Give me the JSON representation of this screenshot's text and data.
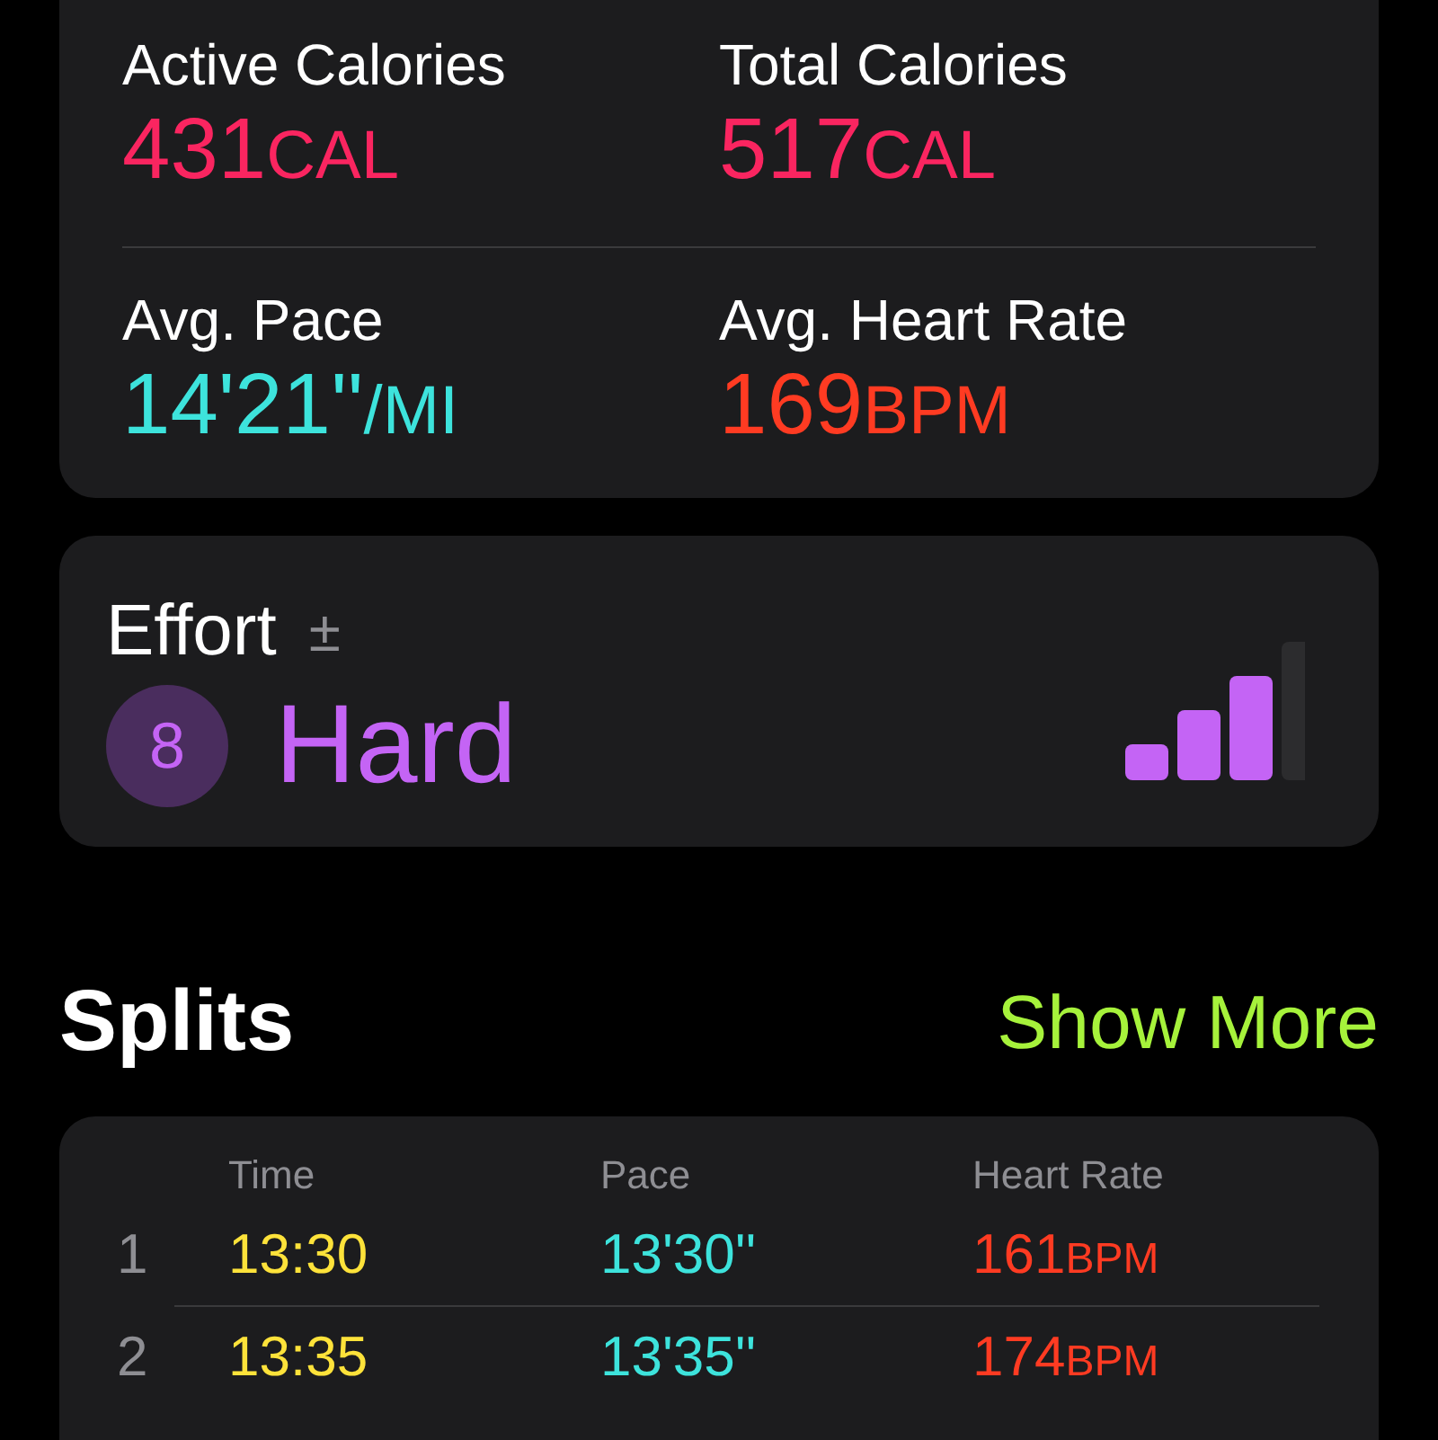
{
  "metrics": [
    {
      "label": "Active Calories",
      "value": "431",
      "unit": "CAL",
      "color": "#fa2560"
    },
    {
      "label": "Total Calories",
      "value": "517",
      "unit": "CAL",
      "color": "#fa2560"
    },
    {
      "label": "Avg. Pace",
      "value": "14'21''",
      "unit": "/MI",
      "color": "#3de3dc"
    },
    {
      "label": "Avg. Heart Rate",
      "value": "169",
      "unit": "BPM",
      "color": "#ff3b22"
    }
  ],
  "effort": {
    "title": "Effort",
    "adjust_symbol": "±",
    "score": "8",
    "rating": "Hard",
    "level": 0.75
  },
  "splits": {
    "title": "Splits",
    "action": "Show More",
    "columns": [
      "Time",
      "Pace",
      "Heart Rate"
    ],
    "rows": [
      {
        "index": "1",
        "time": "13:30",
        "pace": "13'30''",
        "heart_rate": "161",
        "unit": "BPM"
      },
      {
        "index": "2",
        "time": "13:35",
        "pace": "13'35''",
        "heart_rate": "174",
        "unit": "BPM"
      }
    ]
  }
}
